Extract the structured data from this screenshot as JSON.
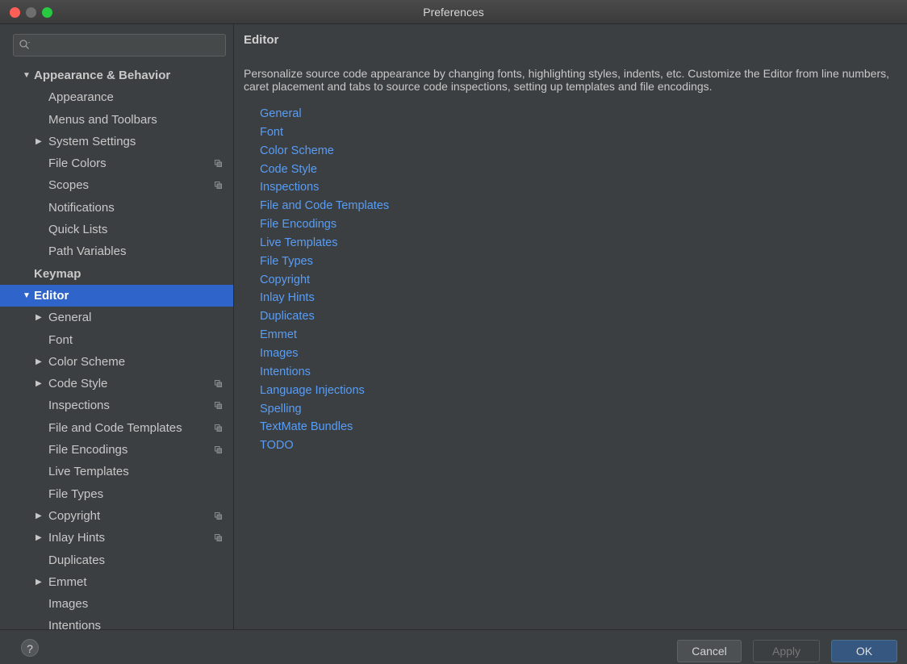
{
  "window": {
    "title": "Preferences"
  },
  "search": {
    "value": "",
    "placeholder": ""
  },
  "sidebar": {
    "items": [
      {
        "label": "Appearance & Behavior",
        "level": 0,
        "expanded": true,
        "bold": true,
        "copy": false
      },
      {
        "label": "Appearance",
        "level": 1,
        "copy": false
      },
      {
        "label": "Menus and Toolbars",
        "level": 1,
        "copy": false
      },
      {
        "label": "System Settings",
        "level": 1,
        "collapsed": true,
        "copy": false
      },
      {
        "label": "File Colors",
        "level": 1,
        "copy": true
      },
      {
        "label": "Scopes",
        "level": 1,
        "copy": true
      },
      {
        "label": "Notifications",
        "level": 1,
        "copy": false
      },
      {
        "label": "Quick Lists",
        "level": 1,
        "copy": false
      },
      {
        "label": "Path Variables",
        "level": 1,
        "copy": false
      },
      {
        "label": "Keymap",
        "level": 0,
        "bold": true,
        "copy": false
      },
      {
        "label": "Editor",
        "level": 0,
        "expanded": true,
        "bold": true,
        "selected": true,
        "copy": false
      },
      {
        "label": "General",
        "level": 1,
        "collapsed": true,
        "copy": false
      },
      {
        "label": "Font",
        "level": 1,
        "copy": false
      },
      {
        "label": "Color Scheme",
        "level": 1,
        "collapsed": true,
        "copy": false
      },
      {
        "label": "Code Style",
        "level": 1,
        "collapsed": true,
        "copy": true
      },
      {
        "label": "Inspections",
        "level": 1,
        "copy": true
      },
      {
        "label": "File and Code Templates",
        "level": 1,
        "copy": true
      },
      {
        "label": "File Encodings",
        "level": 1,
        "copy": true
      },
      {
        "label": "Live Templates",
        "level": 1,
        "copy": false
      },
      {
        "label": "File Types",
        "level": 1,
        "copy": false
      },
      {
        "label": "Copyright",
        "level": 1,
        "collapsed": true,
        "copy": true
      },
      {
        "label": "Inlay Hints",
        "level": 1,
        "collapsed": true,
        "copy": true
      },
      {
        "label": "Duplicates",
        "level": 1,
        "copy": false
      },
      {
        "label": "Emmet",
        "level": 1,
        "collapsed": true,
        "copy": false
      },
      {
        "label": "Images",
        "level": 1,
        "copy": false
      },
      {
        "label": "Intentions",
        "level": 1,
        "copy": false
      }
    ]
  },
  "content": {
    "title": "Editor",
    "description": "Personalize source code appearance by changing fonts, highlighting styles, indents, etc. Customize the Editor from line numbers, caret placement and tabs to source code inspections, setting up templates and file encodings.",
    "links": [
      "General",
      "Font",
      "Color Scheme",
      "Code Style",
      "Inspections",
      "File and Code Templates",
      "File Encodings",
      "Live Templates",
      "File Types",
      "Copyright",
      "Inlay Hints",
      "Duplicates",
      "Emmet",
      "Images",
      "Intentions",
      "Language Injections",
      "Spelling",
      "TextMate Bundles",
      "TODO"
    ]
  },
  "footer": {
    "help_label": "?",
    "cancel_label": "Cancel",
    "apply_label": "Apply",
    "ok_label": "OK"
  },
  "colors": {
    "background": "#3c3f41",
    "selection": "#2f65ca",
    "link": "#589df6",
    "ok_button": "#365880"
  }
}
